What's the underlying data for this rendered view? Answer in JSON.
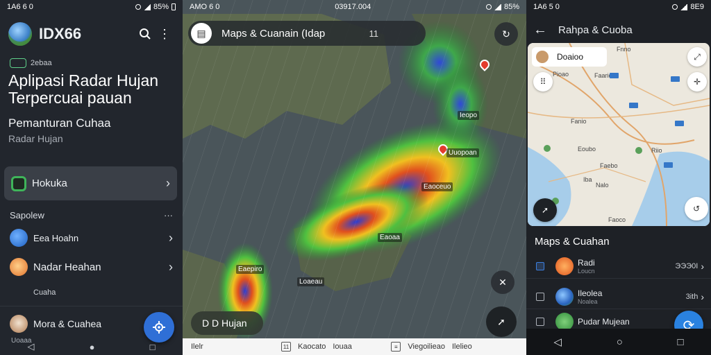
{
  "screen1": {
    "status": {
      "time": "1A6 6 0",
      "battery": "85%"
    },
    "app_name": "IDX66",
    "tag_text": "2ebaa",
    "headline": "Aplipasi Radar Hujan Terpercuai pauan",
    "subtitle": "Pemanturan Cuhaa",
    "subtitle2": "Radar Hujan",
    "card_label": "Hokuka",
    "section_title": "Sapolew",
    "section_more": "···",
    "items": [
      {
        "label": "Eea Hoahn"
      },
      {
        "label": "Nadar Heahan",
        "caption": "Cuaha"
      },
      {
        "label": "Mora & Cuahea",
        "caption": "Uoaaa"
      }
    ]
  },
  "screen2": {
    "status": {
      "time": "AMO 6 0",
      "center": "03917.004",
      "battery": "85%"
    },
    "search_text": "Maps & Cuanain (Idap",
    "search_suffix": "11",
    "map_labels": [
      "Ieopo",
      "Uuopoan",
      "Eaoceuo",
      "Eaoaa",
      "Eaepiro",
      "Loaeau"
    ],
    "chip_text": "D D Hujan",
    "bottom_tabs": [
      "Ilelr",
      "Kaocato",
      "Iouaa",
      "Viegoilieao",
      "Ilelieo"
    ]
  },
  "screen3": {
    "status": {
      "time": "1A6 5 0",
      "battery": "8E9"
    },
    "title": "Rahpa & Cuoba",
    "map_card": "Doaioo",
    "map_labels": [
      "Fnno",
      "Pioao",
      "Faario",
      "Fanio",
      "Eoubo",
      "Riio",
      "Iba",
      "Faebo",
      "Nalo",
      "Faoco"
    ],
    "list_title": "Maps & Cuahan",
    "rows": [
      {
        "label": "Radi",
        "caption": "Loucn",
        "value": "ЭЭЭ0I"
      },
      {
        "label": "Ileolea",
        "caption": "Noalea",
        "value": "3ith"
      },
      {
        "label": "Pudar Mujean",
        "caption": "",
        "value": ""
      }
    ]
  }
}
